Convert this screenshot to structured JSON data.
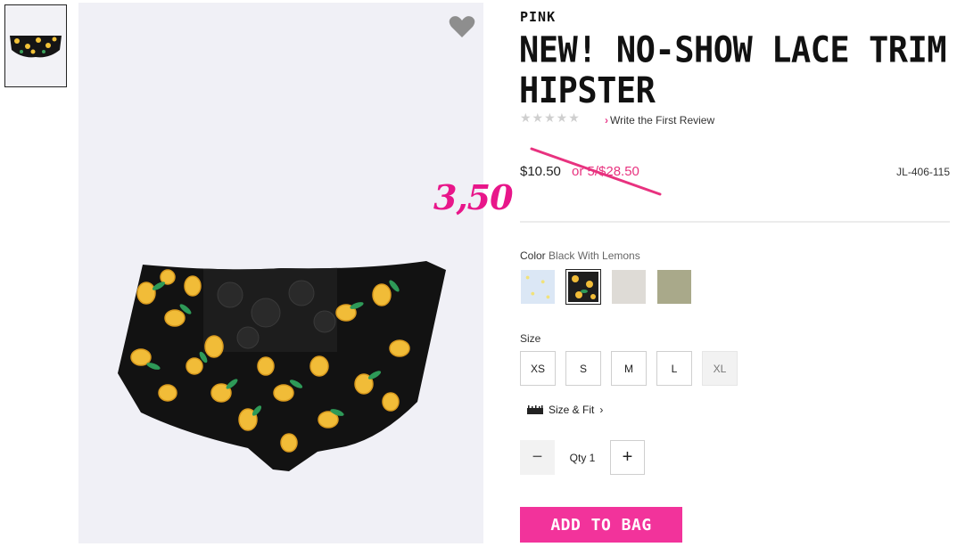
{
  "brand": "PINK",
  "product": {
    "title": "NEW! NO-SHOW LACE TRIM HIPSTER",
    "rating_stars": "★★★★★",
    "review_link": "Write the First Review",
    "price": "$10.50",
    "old_price": "or 5/$28.50",
    "sku": "JL-406-115"
  },
  "annotation": "3,50",
  "color": {
    "label": "Color",
    "value": "Black With Lemons",
    "swatches": [
      {
        "name": "light-blue-print",
        "color": "#dbe7f5"
      },
      {
        "name": "black-with-lemons",
        "color": "#1e1e1e"
      },
      {
        "name": "heather-grey",
        "color": "#dedbd6"
      },
      {
        "name": "olive",
        "color": "#a9a98a"
      }
    ]
  },
  "size": {
    "label": "Size",
    "options": [
      "XS",
      "S",
      "M",
      "L",
      "XL"
    ],
    "size_fit": "Size & Fit"
  },
  "quantity": {
    "label": "Qty 1",
    "minus": "−",
    "plus": "+"
  },
  "cta": "ADD TO BAG",
  "colors": {
    "accent_pink": "#f2339b",
    "strike_pink": "#e8327f",
    "annotation_pink": "#e8168a"
  }
}
